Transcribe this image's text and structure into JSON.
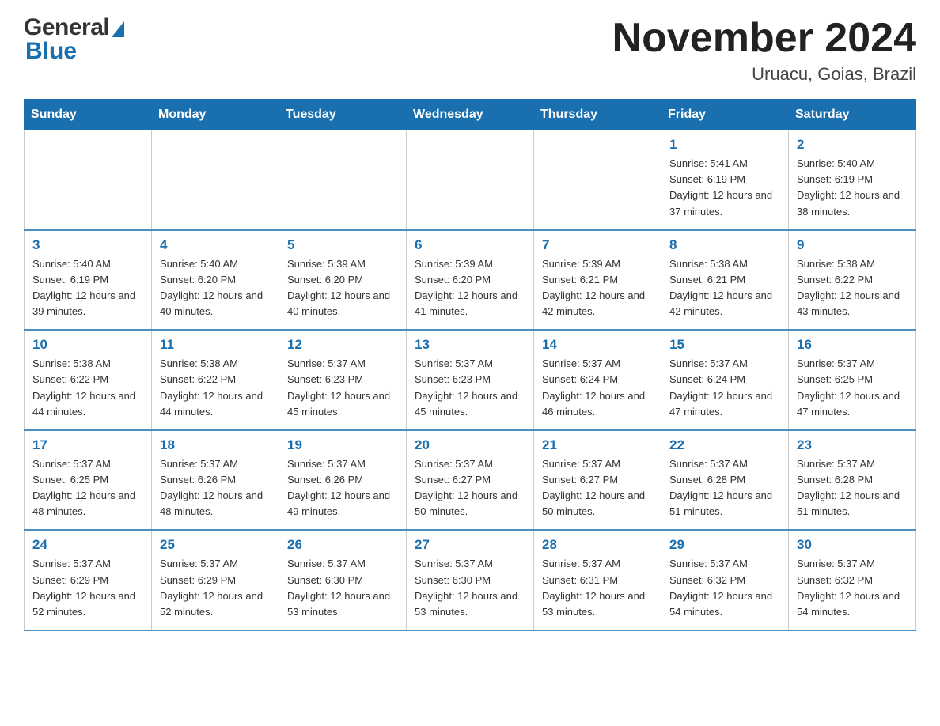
{
  "logo": {
    "general": "General",
    "blue": "Blue"
  },
  "header": {
    "title": "November 2024",
    "location": "Uruacu, Goias, Brazil"
  },
  "days_of_week": [
    "Sunday",
    "Monday",
    "Tuesday",
    "Wednesday",
    "Thursday",
    "Friday",
    "Saturday"
  ],
  "weeks": [
    [
      {
        "day": "",
        "info": ""
      },
      {
        "day": "",
        "info": ""
      },
      {
        "day": "",
        "info": ""
      },
      {
        "day": "",
        "info": ""
      },
      {
        "day": "",
        "info": ""
      },
      {
        "day": "1",
        "info": "Sunrise: 5:41 AM\nSunset: 6:19 PM\nDaylight: 12 hours and 37 minutes."
      },
      {
        "day": "2",
        "info": "Sunrise: 5:40 AM\nSunset: 6:19 PM\nDaylight: 12 hours and 38 minutes."
      }
    ],
    [
      {
        "day": "3",
        "info": "Sunrise: 5:40 AM\nSunset: 6:19 PM\nDaylight: 12 hours and 39 minutes."
      },
      {
        "day": "4",
        "info": "Sunrise: 5:40 AM\nSunset: 6:20 PM\nDaylight: 12 hours and 40 minutes."
      },
      {
        "day": "5",
        "info": "Sunrise: 5:39 AM\nSunset: 6:20 PM\nDaylight: 12 hours and 40 minutes."
      },
      {
        "day": "6",
        "info": "Sunrise: 5:39 AM\nSunset: 6:20 PM\nDaylight: 12 hours and 41 minutes."
      },
      {
        "day": "7",
        "info": "Sunrise: 5:39 AM\nSunset: 6:21 PM\nDaylight: 12 hours and 42 minutes."
      },
      {
        "day": "8",
        "info": "Sunrise: 5:38 AM\nSunset: 6:21 PM\nDaylight: 12 hours and 42 minutes."
      },
      {
        "day": "9",
        "info": "Sunrise: 5:38 AM\nSunset: 6:22 PM\nDaylight: 12 hours and 43 minutes."
      }
    ],
    [
      {
        "day": "10",
        "info": "Sunrise: 5:38 AM\nSunset: 6:22 PM\nDaylight: 12 hours and 44 minutes."
      },
      {
        "day": "11",
        "info": "Sunrise: 5:38 AM\nSunset: 6:22 PM\nDaylight: 12 hours and 44 minutes."
      },
      {
        "day": "12",
        "info": "Sunrise: 5:37 AM\nSunset: 6:23 PM\nDaylight: 12 hours and 45 minutes."
      },
      {
        "day": "13",
        "info": "Sunrise: 5:37 AM\nSunset: 6:23 PM\nDaylight: 12 hours and 45 minutes."
      },
      {
        "day": "14",
        "info": "Sunrise: 5:37 AM\nSunset: 6:24 PM\nDaylight: 12 hours and 46 minutes."
      },
      {
        "day": "15",
        "info": "Sunrise: 5:37 AM\nSunset: 6:24 PM\nDaylight: 12 hours and 47 minutes."
      },
      {
        "day": "16",
        "info": "Sunrise: 5:37 AM\nSunset: 6:25 PM\nDaylight: 12 hours and 47 minutes."
      }
    ],
    [
      {
        "day": "17",
        "info": "Sunrise: 5:37 AM\nSunset: 6:25 PM\nDaylight: 12 hours and 48 minutes."
      },
      {
        "day": "18",
        "info": "Sunrise: 5:37 AM\nSunset: 6:26 PM\nDaylight: 12 hours and 48 minutes."
      },
      {
        "day": "19",
        "info": "Sunrise: 5:37 AM\nSunset: 6:26 PM\nDaylight: 12 hours and 49 minutes."
      },
      {
        "day": "20",
        "info": "Sunrise: 5:37 AM\nSunset: 6:27 PM\nDaylight: 12 hours and 50 minutes."
      },
      {
        "day": "21",
        "info": "Sunrise: 5:37 AM\nSunset: 6:27 PM\nDaylight: 12 hours and 50 minutes."
      },
      {
        "day": "22",
        "info": "Sunrise: 5:37 AM\nSunset: 6:28 PM\nDaylight: 12 hours and 51 minutes."
      },
      {
        "day": "23",
        "info": "Sunrise: 5:37 AM\nSunset: 6:28 PM\nDaylight: 12 hours and 51 minutes."
      }
    ],
    [
      {
        "day": "24",
        "info": "Sunrise: 5:37 AM\nSunset: 6:29 PM\nDaylight: 12 hours and 52 minutes."
      },
      {
        "day": "25",
        "info": "Sunrise: 5:37 AM\nSunset: 6:29 PM\nDaylight: 12 hours and 52 minutes."
      },
      {
        "day": "26",
        "info": "Sunrise: 5:37 AM\nSunset: 6:30 PM\nDaylight: 12 hours and 53 minutes."
      },
      {
        "day": "27",
        "info": "Sunrise: 5:37 AM\nSunset: 6:30 PM\nDaylight: 12 hours and 53 minutes."
      },
      {
        "day": "28",
        "info": "Sunrise: 5:37 AM\nSunset: 6:31 PM\nDaylight: 12 hours and 53 minutes."
      },
      {
        "day": "29",
        "info": "Sunrise: 5:37 AM\nSunset: 6:32 PM\nDaylight: 12 hours and 54 minutes."
      },
      {
        "day": "30",
        "info": "Sunrise: 5:37 AM\nSunset: 6:32 PM\nDaylight: 12 hours and 54 minutes."
      }
    ]
  ]
}
